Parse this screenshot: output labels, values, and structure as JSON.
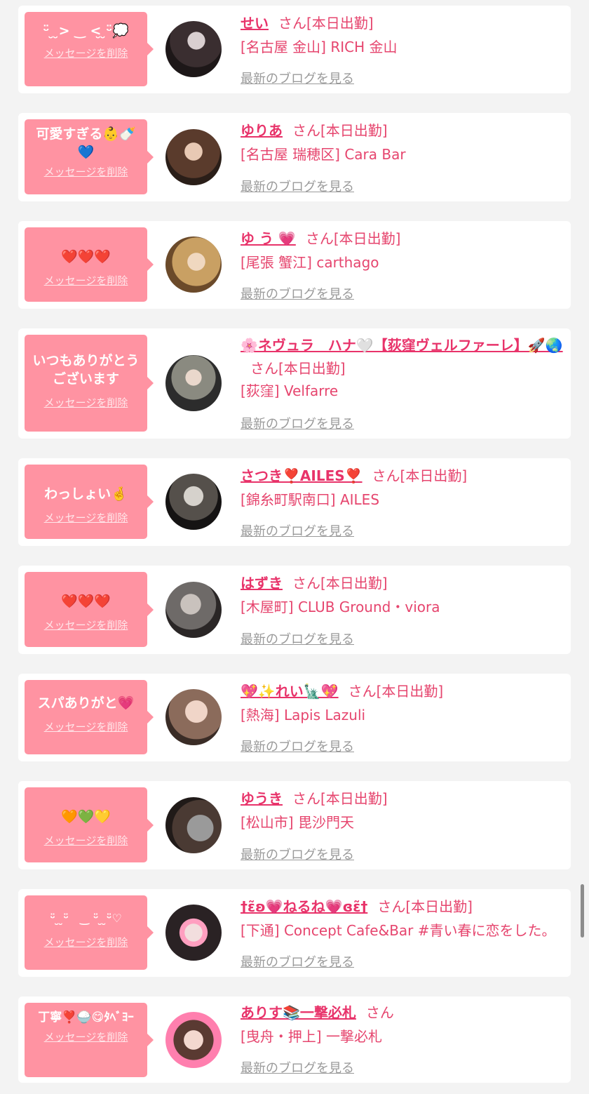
{
  "suffix_san": "さん",
  "today_label": "[本日出勤]",
  "delete_label": "メッセージを削除",
  "blog_label": "最新のブログを見る",
  "colors": {
    "page_bg": "#f3f3f3",
    "bubble": "#ff93a2",
    "name": "#e8336a",
    "link_gray": "#9a9a9a"
  },
  "items": [
    {
      "message": "ᵕ̈ ̮ ̮> ‿ <̮ ̮ᵕ̈💭",
      "name": "せい",
      "shop": "[名古屋 金山] RICH 金山",
      "today": true
    },
    {
      "message": "可愛すぎる👶🍼💙",
      "name": "ゆりあ",
      "shop": "[名古屋 瑞穂区] Cara Bar",
      "today": true
    },
    {
      "message": "❤️❤️❤️",
      "name": "ゆ う 💗",
      "shop": "[尾張 蟹江] carthago",
      "today": true
    },
    {
      "message": "いつもありがとうございます",
      "name": "🌸ネヴュラ　ハナ🤍【荻窪ヴェルファーレ】🚀🌏",
      "shop": "[荻窪] Velfarre",
      "today": true
    },
    {
      "message": "わっしょい🤞",
      "name": "さつき❣️AILES❣️",
      "shop": "[錦糸町駅南口] AILES",
      "today": true
    },
    {
      "message": "❤️❤️❤️",
      "name": "はずき",
      "shop": "[木屋町] CLUB Ground・viora",
      "today": true
    },
    {
      "message": "スパありがと💗",
      "name": "💖✨れい🗽💖",
      "shop": "[熱海] Lapis Lazuli",
      "today": true
    },
    {
      "message": "🧡💚💛",
      "name": "ゆうき",
      "shop": "[松山市] 毘沙門天",
      "today": true
    },
    {
      "message": "ᵕ̈ ̮ ̮ᵕ̈　‿ ᵕ̈ ̮ ̮ᵕ̈♡",
      "name": "†ɛ̃ʚ💗ねるね💗ɞɛ̃†",
      "shop": "[下通] Concept Cafe&Bar #青い春に恋をした。",
      "today": true
    },
    {
      "message": "丁寧❣️🍚😋ﾀﾍﾞﾖｰ",
      "name": "ありす📚一撃必札",
      "shop": "[曳舟・押上] 一撃必札",
      "today": false
    }
  ]
}
